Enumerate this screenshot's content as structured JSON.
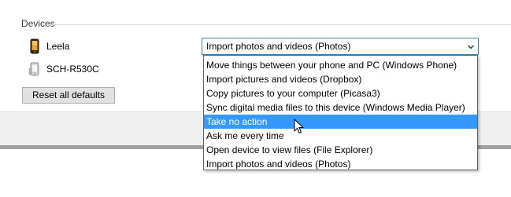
{
  "devices_group": {
    "title": "Devices"
  },
  "devices": [
    {
      "name": "Leela",
      "icon": "phone-icon"
    },
    {
      "name": "SCH-R530C",
      "icon": "phone-icon"
    }
  ],
  "reset_button_label": "Reset all defaults",
  "autoplay_select": {
    "value": "Import photos and videos (Photos)",
    "expanded": true,
    "highlighted_option": "Take no action",
    "options": [
      "Move things between your phone and PC (Windows Phone)",
      "Import pictures and videos (Dropbox)",
      "Copy pictures to your computer (Picasa3)",
      "Sync digital media files to this device (Windows Media Player)",
      "Take no action",
      "Ask me every time",
      "Open device to view files (File Explorer)",
      "Import photos and videos (Photos)"
    ]
  },
  "colors": {
    "highlight": "#3399ff",
    "select_border": "#3c7fb1",
    "button_face": "#e1e1e1"
  }
}
